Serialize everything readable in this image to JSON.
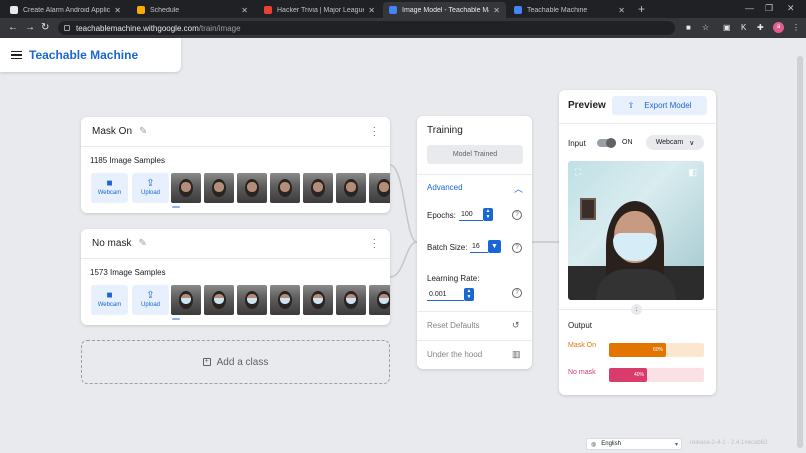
{
  "browser": {
    "tabs": [
      {
        "title": "Create Alarm Android Applicatio",
        "fav_color": "#e8eaed",
        "active": false
      },
      {
        "title": "Schedule",
        "fav_color": "#f9ab00",
        "active": false
      },
      {
        "title": "Hacker Trivia | Major League Hac",
        "fav_color": "#e94235",
        "active": false
      },
      {
        "title": "Image Model - Teachable Ma",
        "fav_color": "#4285f4",
        "active": true
      },
      {
        "title": "Teachable Machine",
        "fav_color": "#4285f4",
        "active": false
      }
    ],
    "tab_close": "✕",
    "new_tab": "+",
    "url_host": "teachablemachine.withgoogle.com",
    "url_path": "/train/image",
    "profile_initial": "a",
    "win_min": "—",
    "win_max": "❐",
    "win_close": "✕"
  },
  "header": {
    "title": "Teachable Machine"
  },
  "classes": [
    {
      "name": "Mask On",
      "samples": "1185 Image Samples",
      "masked": false
    },
    {
      "name": "No mask",
      "samples": "1573 Image Samples",
      "masked": true
    }
  ],
  "source_buttons": {
    "webcam": "Webcam",
    "upload": "Upload"
  },
  "add_class": "Add a class",
  "training": {
    "title": "Training",
    "button": "Model Trained",
    "advanced": "Advanced",
    "epochs_label": "Epochs:",
    "epochs": "100",
    "batch_label": "Batch Size:",
    "batch": "16",
    "lr_label": "Learning Rate:",
    "lr": "0.001",
    "reset": "Reset Defaults",
    "under_hood": "Under the hood"
  },
  "preview": {
    "title": "Preview",
    "export": "Export Model",
    "input_label": "Input",
    "toggle_state": "ON",
    "source": "Webcam",
    "output_label": "Output",
    "outputs": [
      {
        "name": "Mask On",
        "pct_label": "60%",
        "fraction": 0.6,
        "color": "#e37400",
        "bg": "#fde6d0",
        "name_color": "#e37400"
      },
      {
        "name": "No mask",
        "pct_label": "40%",
        "fraction": 0.4,
        "color": "#d93c6a",
        "bg": "#fbe0e6",
        "name_color": "#d93c6a"
      }
    ]
  },
  "footer": {
    "language": "English",
    "version": "release-2-4-1 - 2.4.1#ecab62"
  }
}
